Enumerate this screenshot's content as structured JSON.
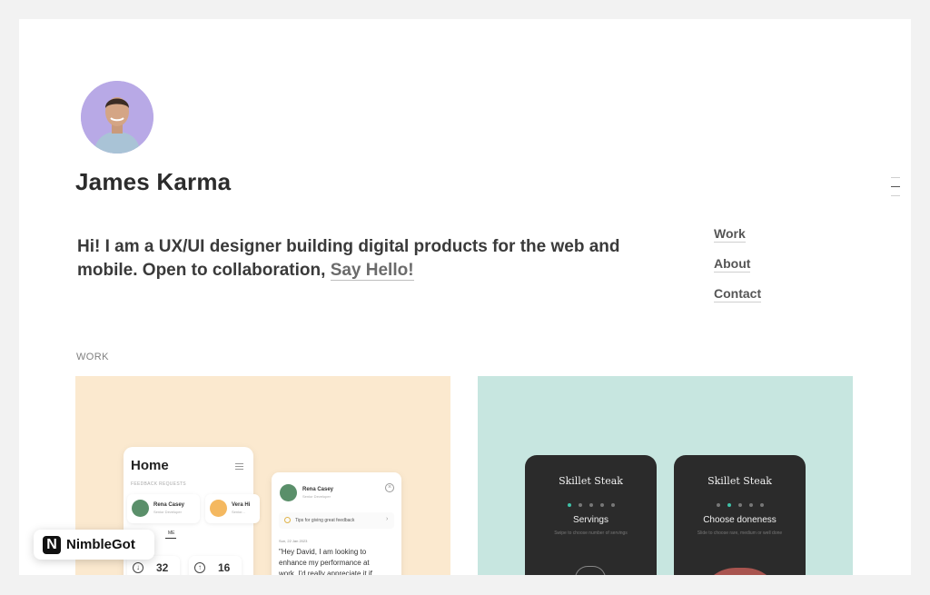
{
  "profile": {
    "name": "James Karma",
    "bio_text": "Hi! I am a UX/UI designer building digital products for the web and mobile. Open to collaboration, ",
    "say_hello": "Say Hello!"
  },
  "nav": {
    "items": [
      {
        "label": "Work"
      },
      {
        "label": "About"
      },
      {
        "label": "Contact"
      }
    ]
  },
  "work": {
    "section_label": "WORK",
    "card1": {
      "home_title": "Home",
      "feedback_label": "FEEDBACK REQUESTS",
      "chips": [
        {
          "name": "Rena Casey",
          "role": "Senior Developer"
        },
        {
          "name": "Vera Hi",
          "role": "Senior..."
        }
      ],
      "me_label": "ME",
      "stats": [
        "32",
        "16"
      ],
      "detail": {
        "name": "Rena Casey",
        "role": "Senior Developer",
        "tip": "Tips for giving great feedback",
        "date": "Sun, 22 Jan 2023",
        "quote": "\"Hey David, I am looking to enhance my performance at work. I'd really appreciate it if"
      }
    },
    "card2": {
      "screens": [
        {
          "title": "Skillet Steak",
          "heading": "Servings",
          "sub": "Swipe to choose number of servings"
        },
        {
          "title": "Skillet Steak",
          "heading": "Choose doneness",
          "sub": "Slide to choose rare, medium or well done"
        }
      ]
    }
  },
  "badge": {
    "logo": "N",
    "label": "NimbleGot"
  },
  "colors": {
    "card1_bg": "#fbe9cf",
    "card2_bg": "#c7e6e0",
    "avatar_bg": "#b8a9e6",
    "accent_teal": "#3fc1a7"
  }
}
